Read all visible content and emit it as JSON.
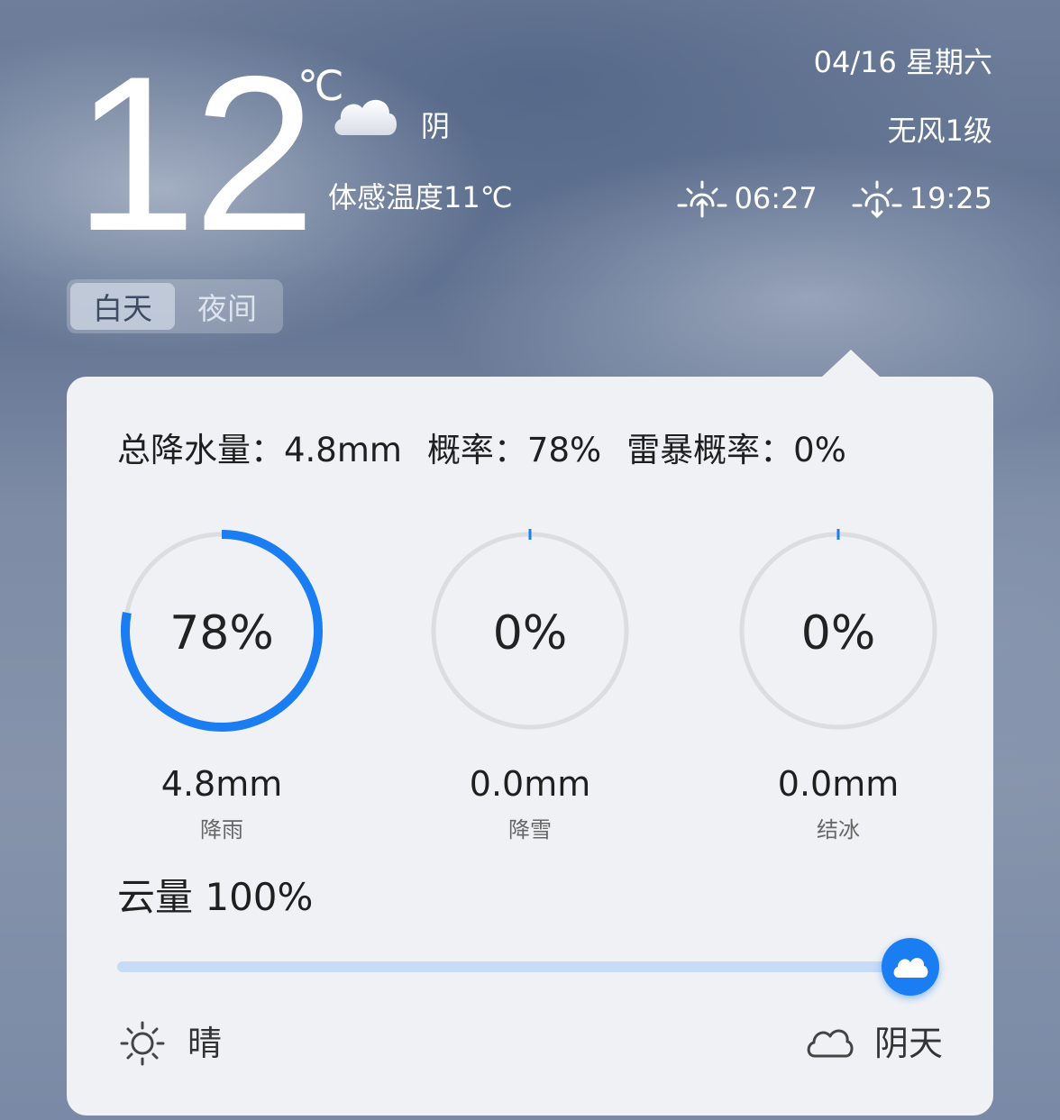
{
  "header": {
    "temperature": "12",
    "unit": "℃",
    "condition": "阴",
    "condition_icon": "cloud-icon",
    "feels_like": "体感温度11℃",
    "date": "04/16 星期六",
    "wind": "无风1级",
    "sunrise": "06:27",
    "sunset": "19:25"
  },
  "toggle": {
    "day": "白天",
    "night": "夜间",
    "selected": "白天"
  },
  "card": {
    "summary": {
      "total_precip": "总降水量：4.8mm",
      "probability": "概率：78%",
      "thunder": "雷暴概率：0%"
    },
    "gauges": [
      {
        "percent": "78%",
        "value": 78,
        "amount": "4.8mm",
        "label": "降雨"
      },
      {
        "percent": "0%",
        "value": 0,
        "amount": "0.0mm",
        "label": "降雪"
      },
      {
        "percent": "0%",
        "value": 0,
        "amount": "0.0mm",
        "label": "结冰"
      }
    ],
    "cloud": {
      "title": "云量 100%",
      "value": 100,
      "min_label": "晴",
      "max_label": "阴天"
    }
  },
  "colors": {
    "accent": "#1a7df2",
    "track": "#c5dbf6",
    "gauge_bg": "#dcdde1"
  }
}
